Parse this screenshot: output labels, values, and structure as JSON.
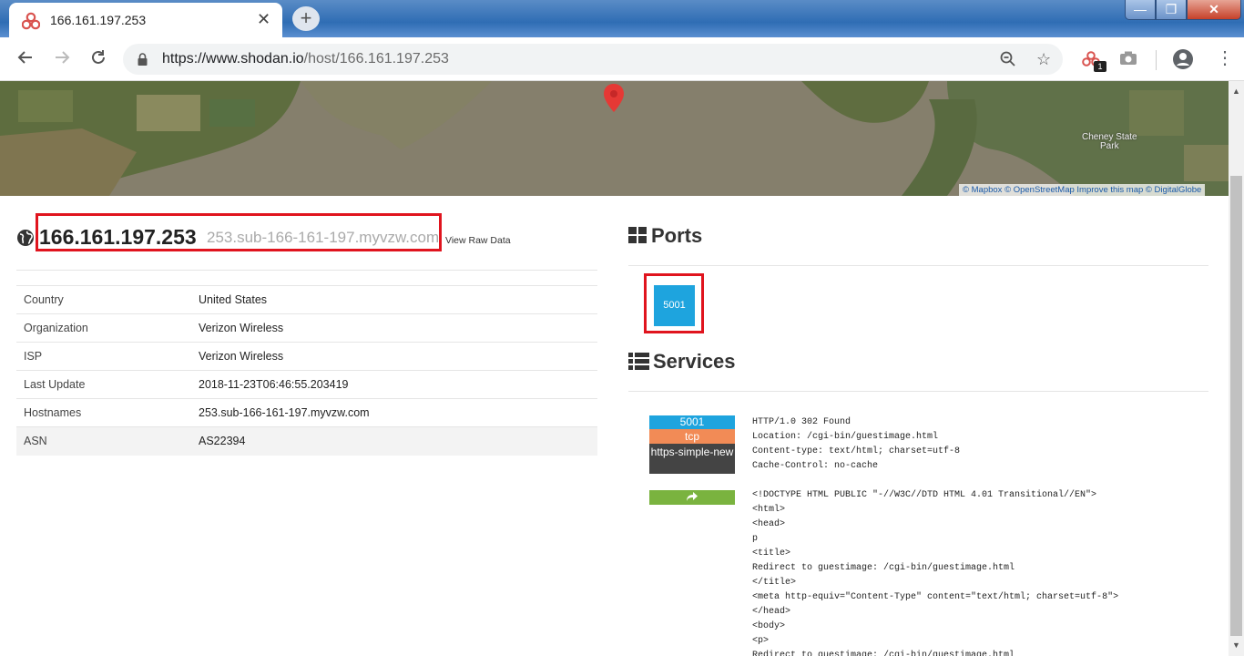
{
  "browser": {
    "tab_title": "166.161.197.253",
    "tab_close": "✕",
    "new_tab": "+",
    "url_scheme_host": "https://www.shodan.io",
    "url_path": "/host/166.161.197.253",
    "ext_badge": "1"
  },
  "window": {
    "minimize": "—",
    "maximize": "❐",
    "close": "✕"
  },
  "map": {
    "place_label_1": "Cheney State",
    "place_label_2": "Park",
    "attribution": "© Mapbox © OpenStreetMap Improve this map © DigitalGlobe"
  },
  "host": {
    "ip": "166.161.197.253",
    "hostname": "253.sub-166-161-197.myvzw.com",
    "raw_link": "View Raw Data"
  },
  "info_rows": [
    {
      "label": "Country",
      "value": "United States"
    },
    {
      "label": "Organization",
      "value": "Verizon Wireless"
    },
    {
      "label": "ISP",
      "value": "Verizon Wireless"
    },
    {
      "label": "Last Update",
      "value": "2018-11-23T06:46:55.203419"
    },
    {
      "label": "Hostnames",
      "value": "253.sub-166-161-197.myvzw.com"
    },
    {
      "label": "ASN",
      "value": "AS22394"
    }
  ],
  "ports": {
    "title": "Ports",
    "list": [
      "5001"
    ]
  },
  "services": {
    "title": "Services",
    "items": [
      {
        "port": "5001",
        "protocol": "tcp",
        "module": "https-simple-new",
        "banner": "HTTP/1.0 302 Found\nLocation: /cgi-bin/guestimage.html\nContent-type: text/html; charset=utf-8\nCache-Control: no-cache\n\n<!DOCTYPE HTML PUBLIC \"-//W3C//DTD HTML 4.01 Transitional//EN\">\n<html>\n<head>\np\n<title>\nRedirect to guestimage: /cgi-bin/guestimage.html\n</title>\n<meta http-equiv=\"Content-Type\" content=\"text/html; charset=utf-8\">\n</head>\n<body>\n<p>\nRedirect to guestimage: /cgi-bin/guestimage.html"
      }
    ]
  },
  "colors": {
    "port_blue": "#1ea4de",
    "tcp_orange": "#f28b56",
    "module_dark": "#444444",
    "link_green": "#7ab33f",
    "highlight_red": "#e0141e"
  }
}
